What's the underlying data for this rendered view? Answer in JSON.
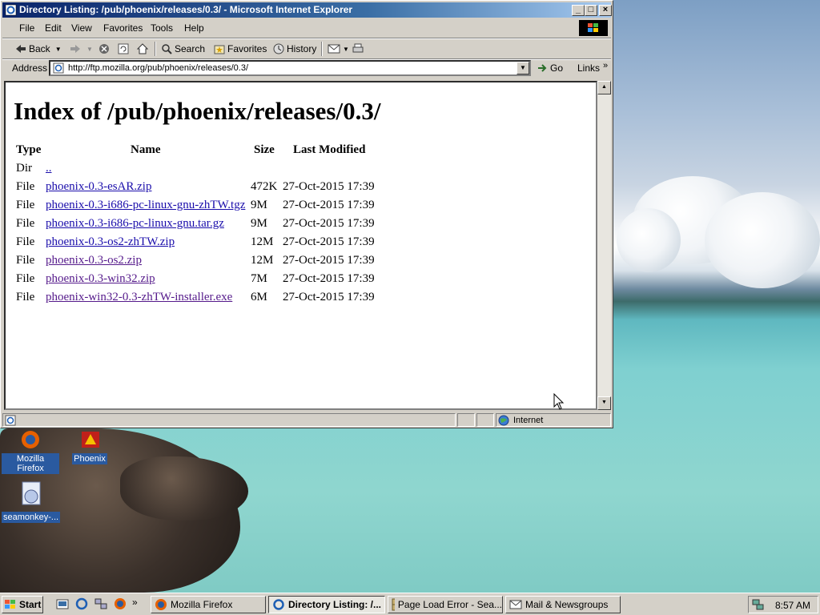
{
  "window": {
    "title": "Directory Listing: /pub/phoenix/releases/0.3/ - Microsoft Internet Explorer",
    "menu": [
      "File",
      "Edit",
      "View",
      "Favorites",
      "Tools",
      "Help"
    ],
    "toolbar": {
      "back": "Back",
      "search": "Search",
      "favorites": "Favorites",
      "history": "History"
    },
    "address": {
      "label": "Address",
      "url": "http://ftp.mozilla.org/pub/phoenix/releases/0.3/",
      "go": "Go",
      "links": "Links"
    },
    "status": {
      "zone": "Internet"
    }
  },
  "page": {
    "heading": "Index of /pub/phoenix/releases/0.3/",
    "columns": {
      "type": "Type",
      "name": "Name",
      "size": "Size",
      "modified": "Last Modified"
    },
    "rows": [
      {
        "type": "Dir",
        "name": "..",
        "size": "",
        "modified": ""
      },
      {
        "type": "File",
        "name": "phoenix-0.3-esAR.zip",
        "size": "472K",
        "modified": "27-Oct-2015 17:39"
      },
      {
        "type": "File",
        "name": "phoenix-0.3-i686-pc-linux-gnu-zhTW.tgz",
        "size": "9M",
        "modified": "27-Oct-2015 17:39"
      },
      {
        "type": "File",
        "name": "phoenix-0.3-i686-pc-linux-gnu.tar.gz",
        "size": "9M",
        "modified": "27-Oct-2015 17:39"
      },
      {
        "type": "File",
        "name": "phoenix-0.3-os2-zhTW.zip",
        "size": "12M",
        "modified": "27-Oct-2015 17:39"
      },
      {
        "type": "File",
        "name": "phoenix-0.3-os2.zip",
        "size": "12M",
        "modified": "27-Oct-2015 17:39"
      },
      {
        "type": "File",
        "name": "phoenix-0.3-win32.zip",
        "size": "7M",
        "modified": "27-Oct-2015 17:39"
      },
      {
        "type": "File",
        "name": "phoenix-win32-0.3-zhTW-installer.exe",
        "size": "6M",
        "modified": "27-Oct-2015 17:39"
      }
    ]
  },
  "desktop": {
    "icons": [
      "Mozilla Firefox",
      "Phoenix",
      "seamonkey-..."
    ]
  },
  "taskbar": {
    "start": "Start",
    "tasks": [
      "Mozilla Firefox",
      "Directory Listing: /...",
      "Page Load Error - Sea...",
      "Mail & Newsgroups"
    ],
    "clock": "8:57 AM"
  },
  "colors": {
    "link": "#1a0dab",
    "visited": "#551a8b",
    "title_bar": "#0a246a"
  }
}
